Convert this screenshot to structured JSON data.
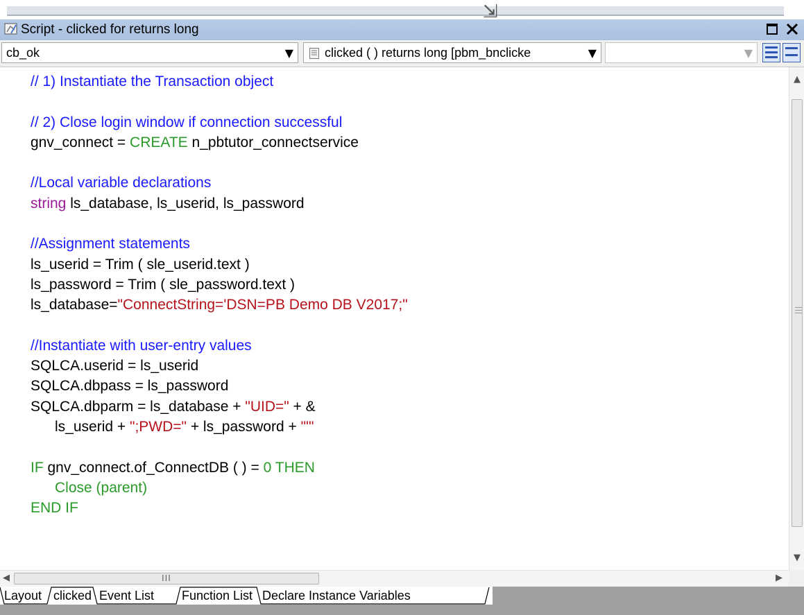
{
  "window": {
    "title": "Script - clicked for  returns long"
  },
  "toolbar": {
    "object_combo": "cb_ok",
    "event_combo": "clicked ( )  returns long [pbm_bnclickе",
    "third_combo": ""
  },
  "code_lines": [
    [
      {
        "t": "// 1) Instantiate the Transaction object",
        "c": "comment"
      }
    ],
    [],
    [
      {
        "t": "// 2) Close login window if connection successful",
        "c": "comment"
      }
    ],
    [
      {
        "t": "gnv_connect = ",
        "c": "plain"
      },
      {
        "t": "CREATE",
        "c": "green"
      },
      {
        "t": " n_pbtutor_connectservice",
        "c": "plain"
      }
    ],
    [],
    [
      {
        "t": "//Local variable declarations",
        "c": "comment"
      }
    ],
    [
      {
        "t": "string",
        "c": "purple"
      },
      {
        "t": " ls_database, ls_userid, ls_password",
        "c": "plain"
      }
    ],
    [],
    [
      {
        "t": "//Assignment statements",
        "c": "comment"
      }
    ],
    [
      {
        "t": "ls_userid = Trim ( sle_userid.text )",
        "c": "plain"
      }
    ],
    [
      {
        "t": "ls_password = Trim ( sle_password.text )",
        "c": "plain"
      }
    ],
    [
      {
        "t": "ls_database=",
        "c": "plain"
      },
      {
        "t": "\"ConnectString='DSN=PB Demo DB V2017;\"",
        "c": "str"
      }
    ],
    [],
    [
      {
        "t": "//Instantiate with user-entry values",
        "c": "comment"
      }
    ],
    [
      {
        "t": "SQLCA.userid = ls_userid",
        "c": "plain"
      }
    ],
    [
      {
        "t": "SQLCA.dbpass = ls_password",
        "c": "plain"
      }
    ],
    [
      {
        "t": "SQLCA.dbparm = ls_database + ",
        "c": "plain"
      },
      {
        "t": "\"UID=\"",
        "c": "str"
      },
      {
        "t": " + &",
        "c": "plain"
      }
    ],
    [
      {
        "t": "      ls_userid + ",
        "c": "plain"
      },
      {
        "t": "\";PWD=\"",
        "c": "str"
      },
      {
        "t": " + ls_password + ",
        "c": "plain"
      },
      {
        "t": "\"'\"",
        "c": "str"
      }
    ],
    [],
    [
      {
        "t": "IF",
        "c": "green"
      },
      {
        "t": " gnv_connect.of_ConnectDB ( ) = ",
        "c": "plain"
      },
      {
        "t": "0",
        "c": "green"
      },
      {
        "t": " ",
        "c": "plain"
      },
      {
        "t": "THEN",
        "c": "green"
      }
    ],
    [
      {
        "t": "      Close (parent)",
        "c": "green"
      }
    ],
    [
      {
        "t": "END IF",
        "c": "green"
      }
    ]
  ],
  "tabs": [
    "Layout",
    "clicked",
    "Event List",
    "Function List",
    "Declare Instance Variables"
  ],
  "colors": {
    "comment": "#1a1aff",
    "keyword": "#2a9a2a",
    "type": "#9a1a9a",
    "string": "#b5121b",
    "titlebar": "#b6cbe6"
  },
  "icons": {
    "title": "script-window-icon",
    "event": "event-script-icon",
    "maximize": "maximize-icon",
    "close": "close-icon"
  }
}
